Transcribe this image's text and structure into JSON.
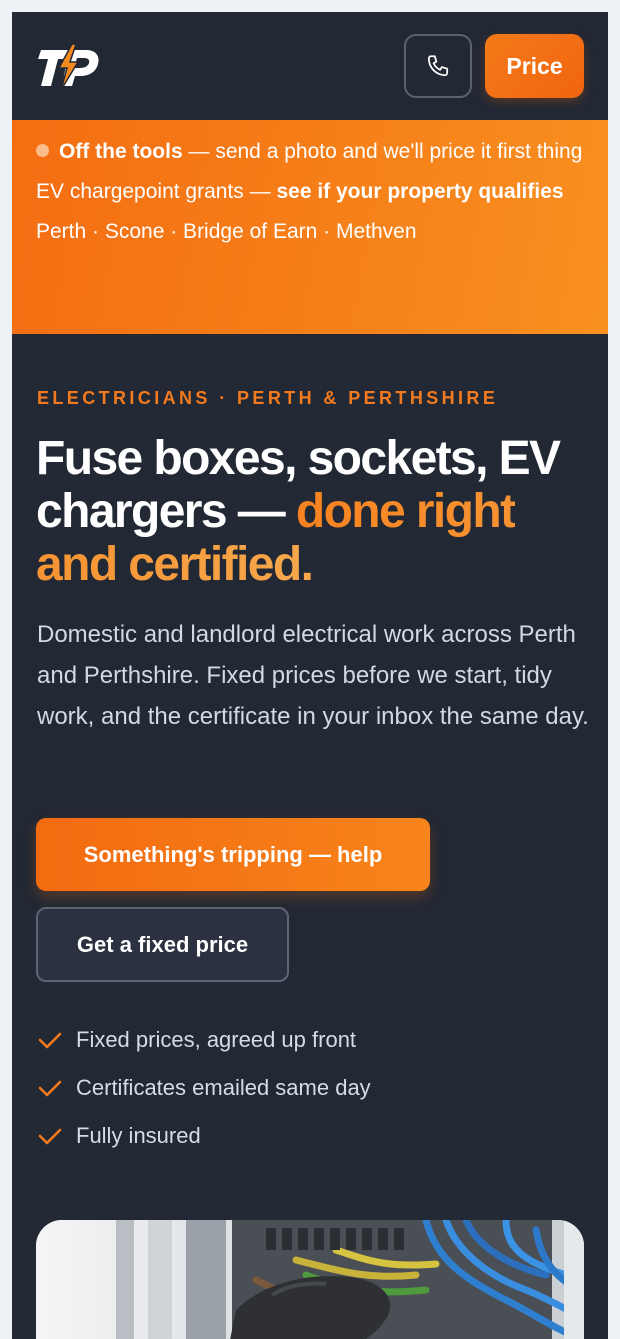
{
  "header": {
    "logo_text": "TP",
    "call_icon": "phone-icon",
    "price_label": "Price"
  },
  "banner": {
    "item1_bold": "Off the tools",
    "item1_rest": " — send a photo and we'll price it first thing",
    "item2_rest": "EV chargepoint grants — ",
    "item2_bold": "see if your property qualifies",
    "towns": "Perth · Scone · Bridge of Earn · Methven"
  },
  "hero": {
    "eyebrow": "ELECTRICIANS · PERTH & PERTHSHIRE",
    "headline_plain": "Fuse boxes, sockets, EV chargers — ",
    "headline_accent": "done right and certified.",
    "lede": "Domestic and landlord electrical work across Perth and Perthshire. Fixed prices before we start, tidy work, and the certificate in your inbox the same day.",
    "cta_primary": "Something's tripping — help",
    "cta_secondary": "Get a fixed price",
    "checks": [
      "Fixed prices, agreed up front",
      "Certificates emailed same day",
      "Fully insured"
    ]
  },
  "colors": {
    "page_bg": "#222834",
    "accent": "#f47a19",
    "banner": "#f67e18"
  }
}
